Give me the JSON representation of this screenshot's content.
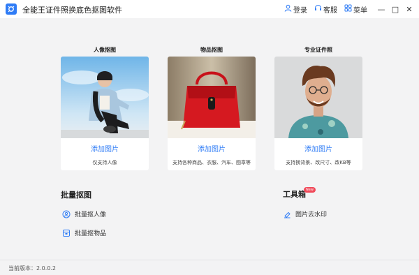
{
  "app": {
    "title": "全能王证件照换底色抠图软件"
  },
  "titlebar": {
    "login_label": "登录",
    "service_label": "客服",
    "menu_label": "菜单",
    "minimize_glyph": "—",
    "maximize_glyph": "□",
    "close_glyph": "✕"
  },
  "cards": [
    {
      "heading": "人像抠图",
      "add_label": "添加图片",
      "desc": "仅支持人像",
      "image_icon": "person-photo"
    },
    {
      "heading": "物品抠图",
      "add_label": "添加图片",
      "desc": "支持各种商品、衣服、汽车、图章等",
      "image_icon": "red-handbag-photo"
    },
    {
      "heading": "专业证件照",
      "add_label": "添加图片",
      "desc": "支持换背景、改尺寸、改KB等",
      "image_icon": "portrait-photo"
    }
  ],
  "batch": {
    "title": "批量抠图",
    "items": [
      {
        "label": "批量抠人像",
        "icon": "person-group-icon"
      },
      {
        "label": "批量抠物品",
        "icon": "box-icon"
      }
    ]
  },
  "toolbox": {
    "title": "工具箱",
    "badge": "New",
    "items": [
      {
        "label": "图片去水印",
        "icon": "eraser-icon"
      }
    ]
  },
  "status": {
    "version": "当前版本：2.0.0.2"
  },
  "colors": {
    "accent": "#2f7cf6",
    "badge": "#f04a5a",
    "background": "#f3f3f4"
  }
}
